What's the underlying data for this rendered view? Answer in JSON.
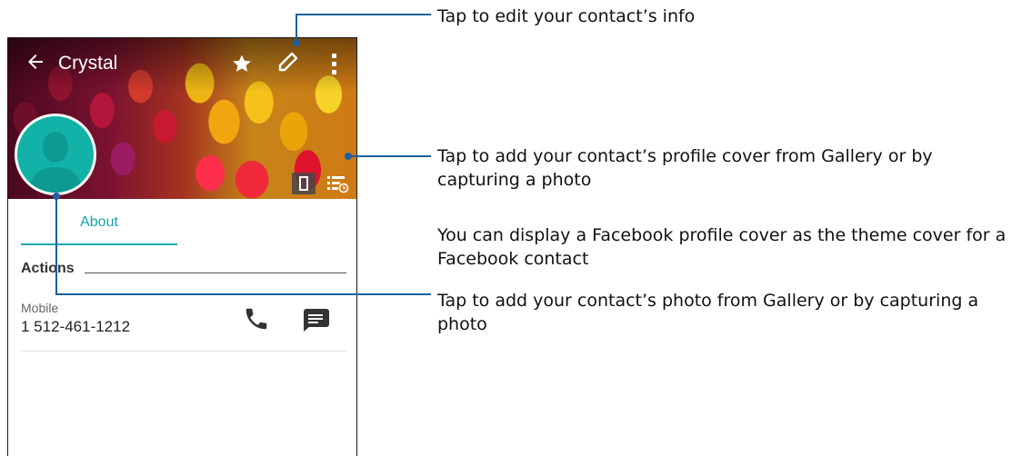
{
  "header": {
    "contact_name": "Crystal"
  },
  "tabs": [
    {
      "label": "About",
      "active": true
    }
  ],
  "sections": {
    "actions_title": "Actions"
  },
  "phone_entry": {
    "type": "Mobile",
    "number": "1 512-461-1212"
  },
  "icons": {
    "back": "arrow-back-icon",
    "favorite": "star-icon",
    "edit": "pencil-icon",
    "menu": "overflow-menu-icon",
    "call": "phone-icon",
    "message": "message-icon",
    "portrait": "portrait-icon",
    "list": "list-clock-icon"
  },
  "callouts": {
    "edit_info": "Tap to edit your contact’s info",
    "profile_cover": "Tap to add your contact’s profile cover from Gallery or by capturing a photo",
    "facebook_cover": "You can display a Facebook profile cover as the theme cover for a Facebook contact",
    "contact_photo": "Tap to add your contact’s photo from Gallery or by capturing a photo"
  },
  "colors": {
    "accent": "#16a3ad",
    "avatar_bg": "#12b2a8",
    "callout_line": "#1f5f9e"
  }
}
